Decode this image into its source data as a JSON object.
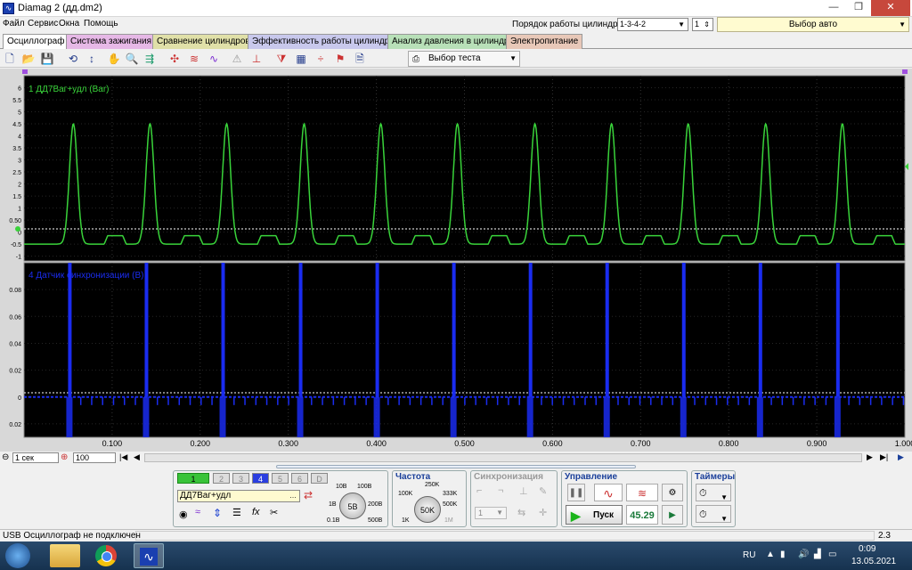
{
  "window": {
    "title": "Diamag 2 (дд.dm2)",
    "minimize": "—",
    "maximize": "❐",
    "close": "✕"
  },
  "menu": [
    "Файл",
    "Сервис",
    "Окна",
    "Помощь"
  ],
  "cylinder_order": {
    "label": "Порядок работы цилиндров",
    "value": "1-3-4-2",
    "spin": "1"
  },
  "auto_select": "Выбор авто",
  "tabs": [
    {
      "label": "Осциллограф",
      "color": "#f0f0f0"
    },
    {
      "label": "Система зажигания",
      "color": "#e6b8e6"
    },
    {
      "label": "Сравнение цилиндров",
      "color": "#e0e0a8"
    },
    {
      "label": "Эффективность работы цилиндров",
      "color": "#c8c8ec"
    },
    {
      "label": "Анализ давления в цилиндре",
      "color": "#b8e0b8"
    },
    {
      "label": "Электропитание",
      "color": "#e8c8b8"
    }
  ],
  "toolbar": {
    "test_select": "Выбор теста"
  },
  "chart_data": [
    {
      "type": "line",
      "title": "1 ДД7Baг+удл (Bar)",
      "color": "#39d33a",
      "x_range": [
        0,
        1.0
      ],
      "ylim": [
        -1.2,
        6.5
      ],
      "yticks": [
        "6",
        "5.5",
        "5",
        "4.5",
        "4",
        "3.5",
        "3",
        "2.5",
        "2",
        "1.5",
        "1",
        "0.50",
        "0",
        "-0.5",
        "-1"
      ],
      "peak_times": [
        0.056,
        0.143,
        0.23,
        0.318,
        0.405,
        0.492,
        0.58,
        0.667,
        0.754,
        0.842,
        0.929
      ],
      "peak_value": 4.5,
      "baseline": -0.5,
      "legend": "none"
    },
    {
      "type": "line",
      "title": "4 Датчик синхронизации (B)",
      "color": "#1a2cf0",
      "x_range": [
        0,
        1.0
      ],
      "ylim": [
        -0.03,
        0.1
      ],
      "yticks": [
        "0.08",
        "0.06",
        "0.04",
        "0.02",
        "0",
        "0.02"
      ],
      "pulse_times": [
        0.052,
        0.139,
        0.226,
        0.314,
        0.401,
        0.488,
        0.575,
        0.662,
        0.749,
        0.836,
        0.924
      ],
      "baseline": 0,
      "legend": "none"
    }
  ],
  "xticks": [
    "0.100",
    "0.200",
    "0.300",
    "0.400",
    "0.500",
    "0.600",
    "0.700",
    "0.800",
    "0.900",
    "1.000"
  ],
  "scroll": {
    "time": "1 сек",
    "zoom": "100"
  },
  "channels": {
    "labels": [
      "1",
      "2",
      "3",
      "4",
      "5",
      "6",
      "D"
    ],
    "active": [
      "1",
      "4"
    ],
    "name": "ДД7Baг+удл",
    "scale_value": "5B",
    "scale_labels": [
      "10B",
      "100B",
      "1B",
      "200B",
      "0.1B",
      "500B"
    ]
  },
  "frequency": {
    "title": "Частота",
    "value": "50K",
    "labels": [
      "250K",
      "100K",
      "333K",
      "500K",
      "1K",
      "1M"
    ]
  },
  "sync": {
    "title": "Синхронизация",
    "value": "1"
  },
  "control": {
    "title": "Управление",
    "start": "Пуск",
    "rate": "45.29"
  },
  "timers": {
    "title": "Таймеры"
  },
  "status": {
    "left": "USB Осциллограф не подключен",
    "right": "2.3"
  },
  "taskbar": {
    "lang": "RU",
    "time": "0:09",
    "date": "13.05.2021"
  }
}
